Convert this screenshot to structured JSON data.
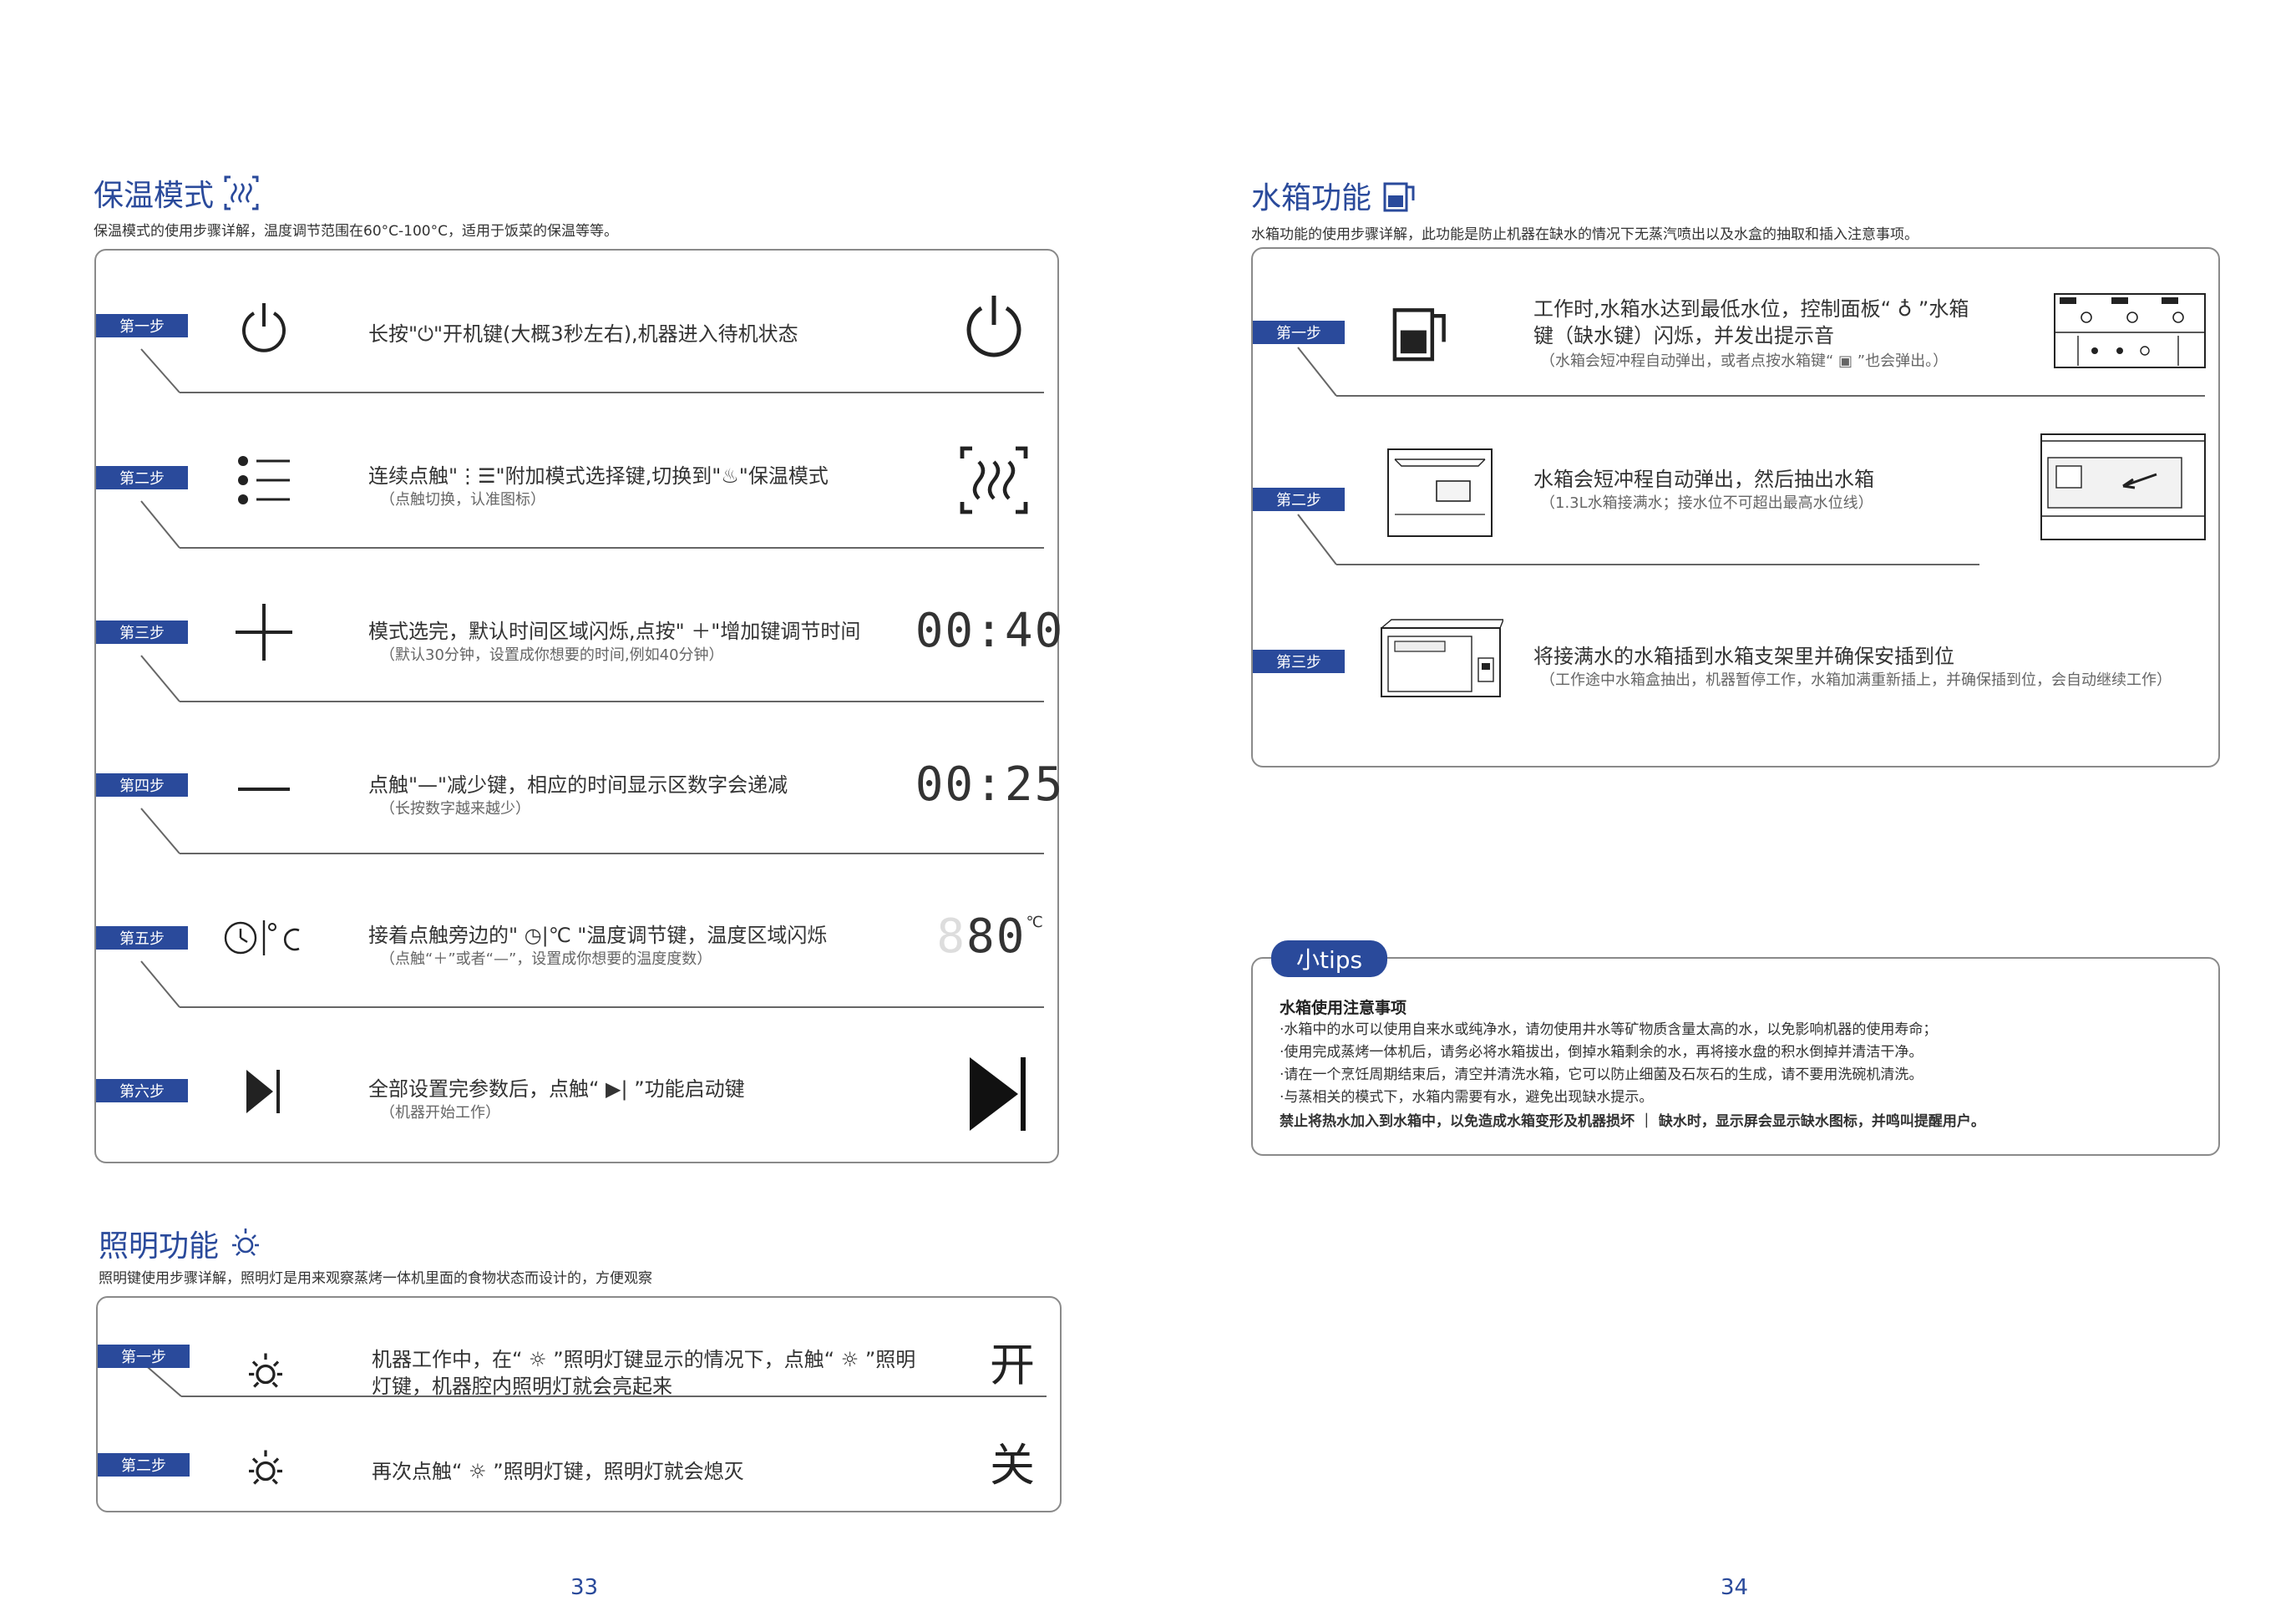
{
  "left": {
    "keepwarm": {
      "title": "保温模式",
      "subtitle": "保温模式的使用步骤详解，温度调节范围在60°C-100°C，适用于饭菜的保温等等。",
      "steps": [
        {
          "badge": "第一步",
          "icon": "power-icon",
          "text": "长按\"⏻\"开机键(大概3秒左右),机器进入待机状态",
          "note": "",
          "right": "power-icon"
        },
        {
          "badge": "第二步",
          "icon": "mode-list-icon",
          "text": "连续点触\"⋮☰\"附加模式选择键,切换到\"♨\"保温模式",
          "note": "（点触切换，认准图标）",
          "right": "keep-warm-icon"
        },
        {
          "badge": "第三步",
          "icon": "plus-icon",
          "text": "模式选完，默认时间区域闪烁,点按\" ＋\"增加键调节时间",
          "note": "（默认30分钟，设置成你想要的时间,例如40分钟）",
          "right_text": "00:40"
        },
        {
          "badge": "第四步",
          "icon": "minus-icon",
          "text": "点触\"—\"减少键，相应的时间显示区数字会递减",
          "note": "（长按数字越来越少）",
          "right_text": "00:25"
        },
        {
          "badge": "第五步",
          "icon": "temperature-icon",
          "text": "接着点触旁边的\" ◷|℃ \"温度调节键，温度区域闪烁",
          "note": "（点触“＋”或者“—”，设置成你想要的温度度数）",
          "right_text": "80",
          "right_unit": "℃"
        },
        {
          "badge": "第六步",
          "icon": "start-icon",
          "text": "全部设置完参数后，点触“ ▶| ”功能启动键",
          "note": "（机器开始工作）",
          "right": "start-icon"
        }
      ]
    },
    "lighting": {
      "title": "照明功能",
      "subtitle": "照明键使用步骤详解，照明灯是用来观察蒸烤一体机里面的食物状态而设计的，方便观察",
      "steps": [
        {
          "badge": "第一步",
          "icon": "light-icon",
          "text_line1": "机器工作中，在“ ☼ ”照明灯键显示的情况下，点触“ ☼ ”照明",
          "text_line2": "灯键，机器腔内照明灯就会亮起来",
          "right_text": "开"
        },
        {
          "badge": "第二步",
          "icon": "light-icon",
          "text": "再次点触“ ☼ ”照明灯键，照明灯就会熄灭",
          "right_text": "关"
        }
      ]
    },
    "page_number": "33"
  },
  "right": {
    "watertank": {
      "title": "水箱功能",
      "subtitle": "水箱功能的使用步骤详解，此功能是防止机器在缺水的情况下无蒸汽喷出以及水盒的抽取和插入注意事项。",
      "steps": [
        {
          "badge": "第一步",
          "icon": "water-tank-icon",
          "text_line1": "工作时,水箱水达到最低水位，控制面板“ ♁ ”水箱",
          "text_line2": "键（缺水键）闪烁，并发出提示音",
          "note": "（水箱会短冲程自动弹出，或者点按水箱键“ ▣ ”也会弹出。）",
          "right": "control-panel-icon"
        },
        {
          "badge": "第二步",
          "icon": "drawer-eject-icon",
          "text": "水箱会短冲程自动弹出，然后抽出水箱",
          "note": "（1.3L水箱接满水；接水位不可超出最高水位线）",
          "right": "pull-out-tank-icon"
        },
        {
          "badge": "第三步",
          "icon": "oven-icon",
          "text": "将接满水的水箱插到水箱支架里并确保安插到位",
          "note": "（工作途中水箱盒抽出，机器暂停工作，水箱加满重新插上，并确保插到位，会自动继续工作）"
        }
      ]
    },
    "tips": {
      "badge": "小tips",
      "heading": "水箱使用注意事项",
      "lines": [
        "·水箱中的水可以使用自来水或纯净水，请勿使用井水等矿物质含量太高的水，以免影响机器的使用寿命；",
        "·使用完成蒸烤一体机后，请务必将水箱拔出，倒掉水箱剩余的水，再将接水盘的积水倒掉并清洁干净。",
        "·请在一个烹饪周期结束后，清空并清洗水箱，它可以防止细菌及石灰石的生成，请不要用洗碗机清洗。",
        "·与蒸相关的模式下，水箱内需要有水，避免出现缺水提示。"
      ],
      "warning": "禁止将热水加入到水箱中，以免造成水箱变形及机器损坏 ｜ 缺水时，显示屏会显示缺水图标，并鸣叫提醒用户。"
    },
    "page_number": "34"
  }
}
